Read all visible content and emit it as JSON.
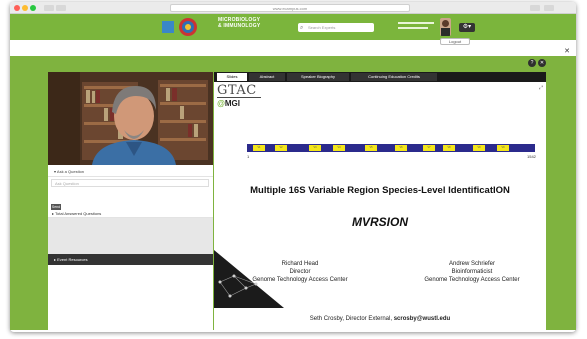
{
  "browser": {
    "url": "www.ecampus.com"
  },
  "banner": {
    "brand_line1": "MICROBIOLOGY",
    "brand_line2": "& IMMUNOLOGY",
    "search_placeholder": "Search Experts",
    "logout_label": "Logout"
  },
  "left_panel": {
    "ask_question": "Ask a Question",
    "question_placeholder": "Ask Question",
    "send_label": "Send",
    "prev_questions": "Total Answered Questions",
    "event_resources": "Event Resources"
  },
  "tabs": [
    {
      "label": "Slides"
    },
    {
      "label": "Abstract"
    },
    {
      "label": "Speaker Biography"
    },
    {
      "label": "Continuing Education Credits"
    }
  ],
  "slide": {
    "logo_top": "GTAC",
    "logo_bottom": "MGI",
    "track_start": "1",
    "track_end": "1542",
    "title": "Multiple 16S Variable Region Species-Level IdentificatION",
    "acronym": "MVRSION",
    "person1": {
      "name": "Richard Head",
      "role": "Director",
      "org": "Genome Technology Access Center"
    },
    "person2": {
      "name": "Andrew Schriefer",
      "role": "Bioinformaticist",
      "org": "Genome Technology Access Center"
    },
    "footer_text": "Seth Crosby, Director External, ",
    "footer_email": "scrosby@wustl.edu"
  },
  "colors": {
    "banner_green": "#7bb53c",
    "track_blue": "#2b2a8c",
    "segment_yellow": "#f4e61a"
  }
}
